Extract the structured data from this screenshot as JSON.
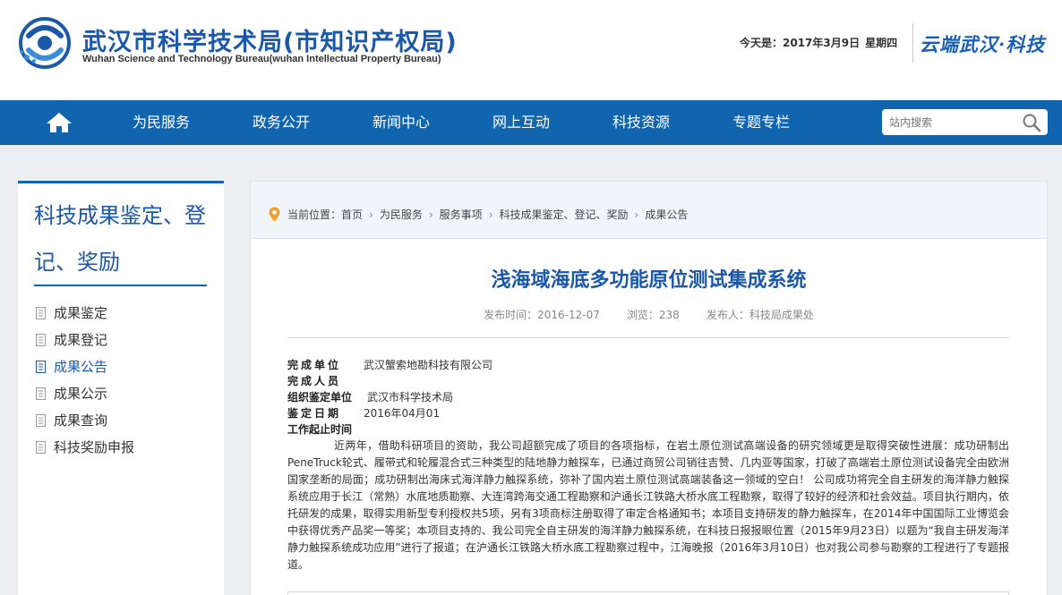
{
  "header": {
    "title": "武汉市科学技术局(市知识产权局)",
    "subtitle": "Wuhan Science and Technology Bureau(wuhan Intellectual Property Bureau)",
    "date_label": "今天是：2017年3月9日",
    "weekday": "星期四",
    "slogan": "云端武汉·科技"
  },
  "nav": {
    "items": [
      "为民服务",
      "政务公开",
      "新闻中心",
      "网上互动",
      "科技资源",
      "专题专栏"
    ],
    "search_placeholder": "站内搜索"
  },
  "sidebar": {
    "title": "科技成果鉴定、登记、奖励",
    "items": [
      {
        "label": "成果鉴定",
        "active": false
      },
      {
        "label": "成果登记",
        "active": false
      },
      {
        "label": "成果公告",
        "active": true
      },
      {
        "label": "成果公示",
        "active": false
      },
      {
        "label": "成果查询",
        "active": false
      },
      {
        "label": "科技奖励申报",
        "active": false
      }
    ]
  },
  "breadcrumb": {
    "prefix": "当前位置：",
    "items": [
      "首页",
      "为民服务",
      "服务事项",
      "科技成果鉴定、登记、奖励",
      "成果公告"
    ]
  },
  "article": {
    "title": "浅海域海底多功能原位测试集成系统",
    "publish_time": "发布时间：2016-12-07",
    "views": "浏览：238",
    "publisher": "发布人：科技局成果处",
    "fields": [
      {
        "label": "完成单位",
        "value": "武汉蟹索地勘科技有限公司"
      },
      {
        "label": "完成人员",
        "value": ""
      },
      {
        "label": "组织鉴定单位",
        "value": "武汉市科学技术局"
      },
      {
        "label": "鉴定日期",
        "value": "2016年04月01"
      },
      {
        "label": "工作起止时间",
        "value": ""
      }
    ],
    "body": "近两年，借助科研项目的资助，我公司超额完成了项目的各项指标，在岩土原位测试高端设备的研究领域更是取得突破性进展：成功研制出PeneTruck轮式、履带式和轮履混合式三种类型的陆地静力触探车，已通过商贸公司销往吉赞、几内亚等国家，打破了高端岩土原位测试设备完全由欧洲国家垄断的局面；成功研制出海床式海洋静力触探系统，弥补了国内岩土原位测试高端装备这一领域的空白！ 公司成功将完全自主研发的海洋静力触探系统应用于长江（常熟）水底地质勘察、大连湾跨海交通工程勘察和沪通长江铁路大桥水底工程勘察，取得了较好的经济和社会效益。项目执行期内，依托研发的成果，取得实用新型专利授权共5项，另有3项商标注册取得了审定合格通知书；本项目支持研发的静力触探车，在2014年中国国际工业博览会中获得优秀产品奖一等奖；本项目支持的、我公司完全自主研发的海洋静力触探系统，在科技日报报眼位置（2015年9月23日）以题为“我自主研发海洋静力触探系统成功应用”进行了报道；在沪通长江铁路大桥水底工程勘察过程中，江海晚报（2016年3月10日）也对我公司参与勘察的工程进行了专题报道。"
  },
  "colors": {
    "brand_blue": "#1165ae",
    "title_blue": "#1b58a8",
    "page_bg": "#eceef1"
  },
  "icons": [
    "bureau-logo-icon",
    "home-icon",
    "search-icon",
    "location-pin-icon",
    "document-icon"
  ]
}
